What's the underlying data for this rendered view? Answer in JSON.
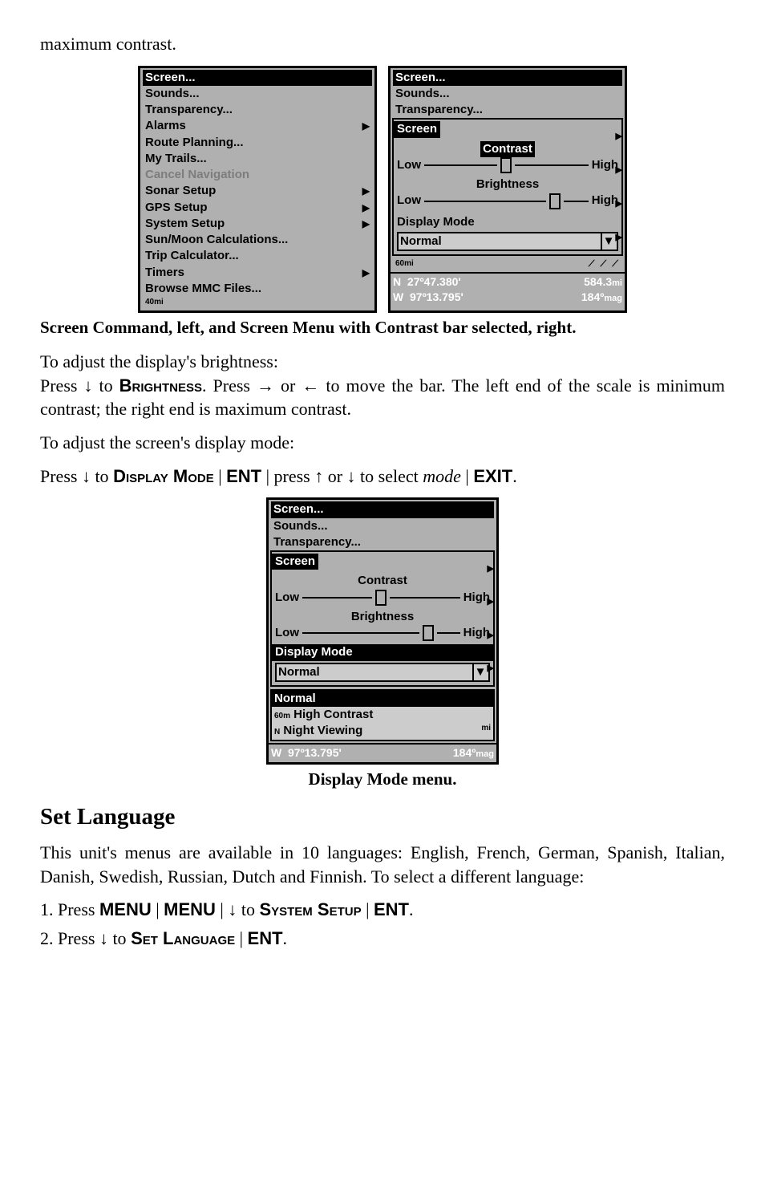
{
  "intro": "maximum contrast.",
  "menu_left": {
    "items": [
      {
        "label": "Screen...",
        "state": "selected"
      },
      {
        "label": "Sounds..."
      },
      {
        "label": "Transparency..."
      },
      {
        "label": "Alarms",
        "sub": true
      },
      {
        "label": "Route Planning..."
      },
      {
        "label": "My Trails..."
      },
      {
        "label": "Cancel Navigation",
        "state": "disabled"
      },
      {
        "label": "Sonar Setup",
        "sub": true
      },
      {
        "label": "GPS Setup",
        "sub": true
      },
      {
        "label": "System Setup",
        "sub": true
      },
      {
        "label": "Sun/Moon Calculations..."
      },
      {
        "label": "Trip Calculator..."
      },
      {
        "label": "Timers",
        "sub": true
      },
      {
        "label": "Browse MMC Files..."
      }
    ],
    "scale": "40mi"
  },
  "screen_panel_right": {
    "above": [
      "Screen...",
      "Sounds...",
      "Transparency..."
    ],
    "title": "Screen",
    "contrast": {
      "label": "Contrast",
      "low": "Low",
      "high": "High",
      "pos": 45,
      "hl": true
    },
    "brightness": {
      "label": "Brightness",
      "low": "Low",
      "high": "High",
      "pos": 78
    },
    "display_mode_label": "Display Mode",
    "display_mode_value": "Normal",
    "status": {
      "scale": "60mi",
      "n": "N",
      "lat": "27º47.380'",
      "dist": "584.3",
      "dist_unit": "mi",
      "w": "W",
      "lon": "97º13.795'",
      "brg": "184º",
      "brg_unit": "mag"
    }
  },
  "caption1": "Screen Command, left, and Screen Menu with Contrast bar selected, right.",
  "para1_a": "To adjust the display's brightness:",
  "para1_b1": "Press ↓ to ",
  "para1_b_bold": "Brightness",
  "para1_b2": ". Press → or ← to move the bar. The left end of the scale is minimum contrast; the right end is maximum contrast.",
  "para2": "To adjust the screen's display mode:",
  "para3_a": "Press ↓ to ",
  "para3_b": "Display Mode",
  "para3_c": " | ",
  "para3_d": "ENT",
  "para3_e": " | press ↑ or ↓ to select ",
  "para3_f": "mode",
  "para3_g": " | ",
  "para3_h": "EXIT",
  "para3_i": ".",
  "screen_panel_center": {
    "above": [
      "Screen...",
      "Sounds...",
      "Transparency..."
    ],
    "title": "Screen",
    "contrast": {
      "label": "Contrast",
      "low": "Low",
      "high": "High",
      "pos": 45
    },
    "brightness": {
      "label": "Brightness",
      "low": "Low",
      "high": "High",
      "pos": 78
    },
    "display_mode_label": "Display Mode",
    "display_mode_value": "Normal",
    "options": [
      {
        "label": "Normal",
        "state": "selected"
      },
      {
        "label": "High Contrast",
        "prefix": "60m"
      },
      {
        "label": "Night Viewing",
        "prefix": "N",
        "suffix": "mi"
      }
    ],
    "status_line": {
      "w": "W",
      "lon": "97º13.795'",
      "brg": "184º",
      "brg_unit": "mag"
    }
  },
  "caption2": "Display Mode menu.",
  "h2": "Set Language",
  "lang_para": "This unit's menus are available in 10 languages: English, French, German, Spanish, Italian, Danish, Swedish, Russian, Dutch and Finnish. To select a different language:",
  "step1_a": "1. Press ",
  "step1_b": "MENU",
  "step1_c": " | ",
  "step1_d": "MENU",
  "step1_e": " | ↓ to ",
  "step1_f": "System Setup",
  "step1_g": " | ",
  "step1_h": "ENT",
  "step1_i": ".",
  "step2_a": "2. Press ↓ to ",
  "step2_b": "Set Language",
  "step2_c": " | ",
  "step2_d": "ENT",
  "step2_e": "."
}
